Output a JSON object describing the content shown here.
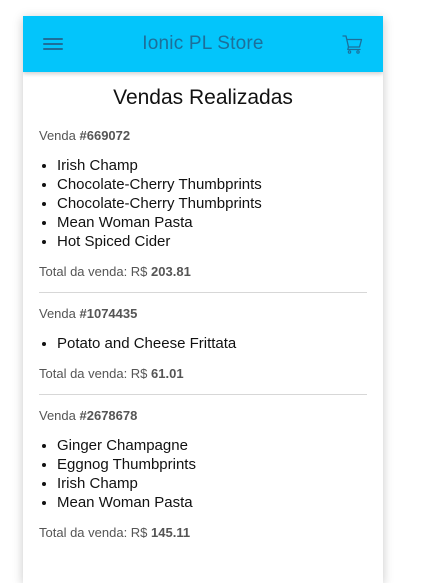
{
  "toolbar": {
    "title": "Ionic PL Store",
    "menu_icon": "menu-icon",
    "cart_icon": "cart-icon"
  },
  "page": {
    "title": "Vendas Realizadas"
  },
  "labels": {
    "sale_prefix": "Venda ",
    "total_prefix": "Total da venda: R$ "
  },
  "sales": [
    {
      "id": "#669072",
      "items": [
        "Irish Champ",
        "Chocolate-Cherry Thumbprints",
        "Chocolate-Cherry Thumbprints",
        "Mean Woman Pasta",
        "Hot Spiced Cider"
      ],
      "total": "203.81"
    },
    {
      "id": "#1074435",
      "items": [
        "Potato and Cheese Frittata"
      ],
      "total": "61.01"
    },
    {
      "id": "#2678678",
      "items": [
        "Ginger Champagne",
        "Eggnog Thumbprints",
        "Irish Champ",
        "Mean Woman Pasta"
      ],
      "total": "145.11"
    }
  ],
  "colors": {
    "toolbar_bg": "#03c5fb",
    "toolbar_text": "#1d6f9a"
  }
}
